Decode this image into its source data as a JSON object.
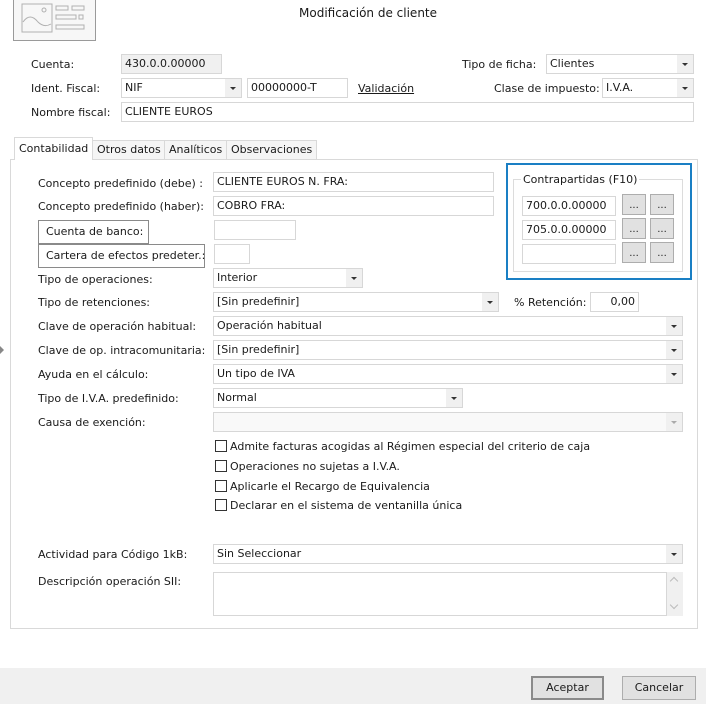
{
  "window": {
    "title": "Modificación de cliente",
    "header_icon": "form-image-icon"
  },
  "header": {
    "cuenta": {
      "label": "Cuenta:",
      "value": "430.0.0.00000"
    },
    "ident_fiscal": {
      "label": "Ident. Fiscal:",
      "type_value": "NIF",
      "number_value": "00000000-T",
      "validation_link": "Validación"
    },
    "nombre_fiscal": {
      "label": "Nombre fiscal:",
      "value": "CLIENTE EUROS"
    },
    "tipo_ficha": {
      "label": "Tipo de ficha:",
      "value": "Clientes"
    },
    "clase_impuesto": {
      "label": "Clase de impuesto:",
      "value": "I.V.A."
    }
  },
  "tabs": [
    {
      "label": "Contabilidad",
      "active": true
    },
    {
      "label": "Otros datos",
      "active": false
    },
    {
      "label": "Analíticos",
      "active": false
    },
    {
      "label": "Observaciones",
      "active": false
    }
  ],
  "contabilidad": {
    "concepto_debe": {
      "label": "Concepto predefinido (debe) :",
      "value": "CLIENTE EUROS N. FRA:"
    },
    "concepto_haber": {
      "label": "Concepto predefinido (haber):",
      "value": "COBRO FRA:"
    },
    "cuenta_banco": {
      "label": "Cuenta de banco:",
      "value": ""
    },
    "cartera_efectos": {
      "label": "Cartera de efectos predeter.:",
      "value": ""
    },
    "tipo_operaciones": {
      "label": "Tipo de operaciones:",
      "value": "Interior"
    },
    "tipo_retenciones": {
      "label": "Tipo de retenciones:",
      "value": "[Sin predefinir]"
    },
    "retencion": {
      "label": "% Retención:",
      "value": "0,00"
    },
    "clave_operacion": {
      "label": "Clave de operación habitual:",
      "value": "Operación habitual"
    },
    "clave_intracomunitaria": {
      "label": "Clave de op. intracomunitaria:",
      "value": "[Sin predefinir]"
    },
    "ayuda_calculo": {
      "label": "Ayuda en el cálculo:",
      "value": "Un tipo de IVA"
    },
    "tipo_iva": {
      "label": "Tipo de I.V.A. predefinido:",
      "value": "Normal"
    },
    "causa_exencion": {
      "label": "Causa de exención:",
      "value": ""
    },
    "checkboxes": [
      {
        "label": "Admite facturas acogidas al Régimen especial del criterio de caja",
        "checked": false
      },
      {
        "label": "Operaciones no sujetas a I.V.A.",
        "checked": false
      },
      {
        "label": "Aplicarle el Recargo de Equivalencia",
        "checked": false
      },
      {
        "label": "Declarar en el sistema de ventanilla única",
        "checked": false
      }
    ],
    "actividad_1kb": {
      "label": "Actividad para Código 1kB:",
      "value": "Sin Seleccionar"
    },
    "descripcion_sii": {
      "label": "Descripción operación SII:",
      "value": ""
    },
    "contrapartidas": {
      "title": "Contrapartidas (F10)",
      "rows": [
        {
          "value": "700.0.0.00000",
          "btn1": "...",
          "btn2": "..."
        },
        {
          "value": "705.0.0.00000",
          "btn1": "...",
          "btn2": "..."
        },
        {
          "value": "",
          "btn1": "...",
          "btn2": "..."
        }
      ],
      "highlight_color": "#1a7fc4"
    }
  },
  "footer": {
    "accept": "Aceptar",
    "cancel": "Cancelar"
  }
}
